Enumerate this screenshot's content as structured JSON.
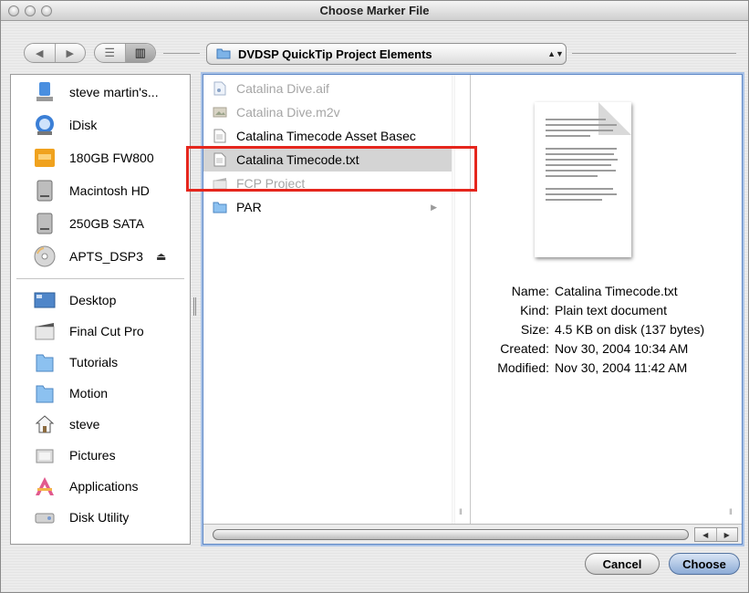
{
  "window": {
    "title": "Choose Marker File"
  },
  "toolbar": {
    "back_label": "◀",
    "forward_label": "▶",
    "list_view_label": "☰",
    "column_view_label": "▥",
    "location": "DVDSP QuickTip Project Elements",
    "location_arrows": "▲▼"
  },
  "sidebar": {
    "devices": [
      {
        "label": "steve martin's...",
        "icon": "network-drive-icon"
      },
      {
        "label": "iDisk",
        "icon": "idisk-icon"
      },
      {
        "label": "180GB FW800",
        "icon": "firewire-drive-icon"
      },
      {
        "label": "Macintosh HD",
        "icon": "hard-drive-icon"
      },
      {
        "label": "250GB SATA",
        "icon": "hard-drive-icon"
      },
      {
        "label": "APTS_DSP3",
        "icon": "disc-icon",
        "eject": "⏏"
      }
    ],
    "places": [
      {
        "label": "Desktop",
        "icon": "desktop-icon"
      },
      {
        "label": "Final Cut Pro",
        "icon": "clapper-folder-icon"
      },
      {
        "label": "Tutorials",
        "icon": "folder-icon"
      },
      {
        "label": "Motion",
        "icon": "folder-icon"
      },
      {
        "label": "steve",
        "icon": "home-icon"
      },
      {
        "label": "Pictures",
        "icon": "pictures-folder-icon"
      },
      {
        "label": "Applications",
        "icon": "applications-icon"
      },
      {
        "label": "Disk Utility",
        "icon": "disk-utility-icon"
      }
    ]
  },
  "files": [
    {
      "name": "Catalina Dive.aif",
      "dim": true,
      "icon": "audio-file-icon"
    },
    {
      "name": "Catalina Dive.m2v",
      "dim": true,
      "icon": "video-file-icon"
    },
    {
      "name": "Catalina Timecode Asset Basec",
      "dim": false,
      "icon": "text-file-icon"
    },
    {
      "name": "Catalina Timecode.txt",
      "dim": false,
      "selected": true,
      "icon": "text-file-icon"
    },
    {
      "name": "FCP Project",
      "dim": true,
      "icon": "fcp-project-icon"
    },
    {
      "name": "PAR",
      "dim": false,
      "folder": true,
      "icon": "folder-icon",
      "arrow": "▶"
    }
  ],
  "preview": {
    "info": [
      {
        "key": "Name:",
        "value": "Catalina Timecode.txt"
      },
      {
        "key": "Kind:",
        "value": "Plain text document"
      },
      {
        "key": "Size:",
        "value": "4.5 KB on disk (137 bytes)"
      },
      {
        "key": "Created:",
        "value": "Nov 30, 2004 10:34 AM"
      },
      {
        "key": "Modified:",
        "value": "Nov 30, 2004 11:42 AM"
      }
    ]
  },
  "scroll": {
    "left_arrow": "◀",
    "right_arrow": "▶"
  },
  "buttons": {
    "cancel": "Cancel",
    "choose": "Choose"
  },
  "colors": {
    "highlight": "#e5261d",
    "selection": "#d4d4d4",
    "focus_ring": "#5d87c6"
  }
}
